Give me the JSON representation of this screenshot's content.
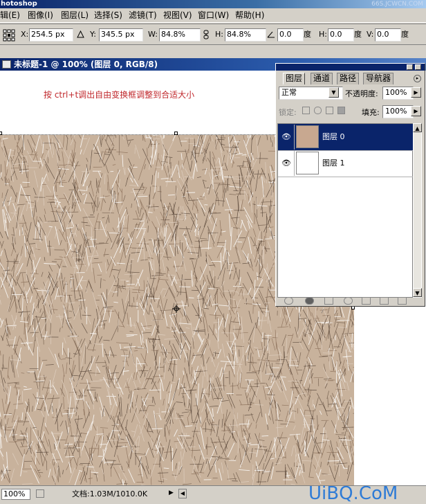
{
  "app": {
    "title": "hotoshop",
    "watermark": "66S.JCWCN.COM"
  },
  "menu": {
    "items": [
      "辑(E)",
      "图像(I)",
      "图层(L)",
      "选择(S)",
      "滤镜(T)",
      "视图(V)",
      "窗口(W)",
      "帮助(H)"
    ]
  },
  "options": {
    "x_label": "X:",
    "x_value": "254.5 px",
    "y_label": "Y:",
    "y_value": "345.5 px",
    "w_label": "W:",
    "w_value": "84.8%",
    "h_label": "H:",
    "h_value": "84.8%",
    "angle_value": "0.0",
    "deg_label": "度",
    "hskew_label": "H:",
    "hskew_value": "0.0",
    "vskew_label": "V:",
    "vskew_value": "0.0"
  },
  "document": {
    "title": "未标题-1 @ 100% (图层 0, RGB/8)",
    "annotation": "按 ctrl+t调出自由变换框调整到合适大小"
  },
  "layers_panel": {
    "tabs": [
      "图层",
      "通道",
      "路径",
      "导航器"
    ],
    "blend_mode": "正常",
    "opacity_label": "不透明度:",
    "opacity_value": "100%",
    "lock_label": "锁定:",
    "fill_label": "填充:",
    "fill_value": "100%",
    "layers": [
      {
        "name": "图层 0",
        "selected": true
      },
      {
        "name": "图层 1",
        "selected": false
      }
    ]
  },
  "status": {
    "zoom": "100%",
    "doc_info": "文档:1.03M/1010.0K"
  },
  "brand": {
    "text": "UiBQ.CoM"
  },
  "colors": {
    "titlebar": "#0a246a",
    "annotation": "#c0282c",
    "fabric_base": "#c8b29c",
    "fabric_dark": "#5a4636",
    "brand": "#2e7bd6"
  }
}
